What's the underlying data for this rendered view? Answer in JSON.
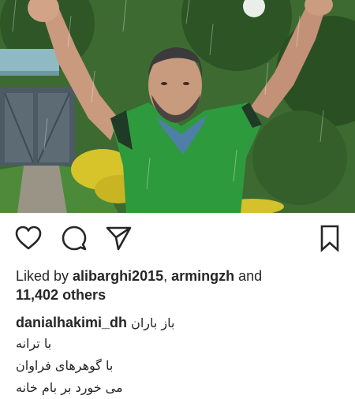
{
  "post": {
    "photo_icon": "photo-of-man-in-rain"
  },
  "actions": {
    "like_icon": "heart-icon",
    "comment_icon": "comment-icon",
    "share_icon": "send-icon",
    "save_icon": "bookmark-icon"
  },
  "likes": {
    "prefix": "Liked by ",
    "user1": "alibarghi2015",
    "separator": ", ",
    "user2": "armingzh",
    "conjunction": " and",
    "count": "11,402 others"
  },
  "caption": {
    "username": "danialhakimi_dh",
    "line1": "باز باران",
    "line2": "با ترانه",
    "line3": "با گوهرهای فراوان",
    "line4": "می خورد بر بام خانه"
  },
  "colors": {
    "text": "#262626",
    "shirt": "#2e9a3e"
  }
}
